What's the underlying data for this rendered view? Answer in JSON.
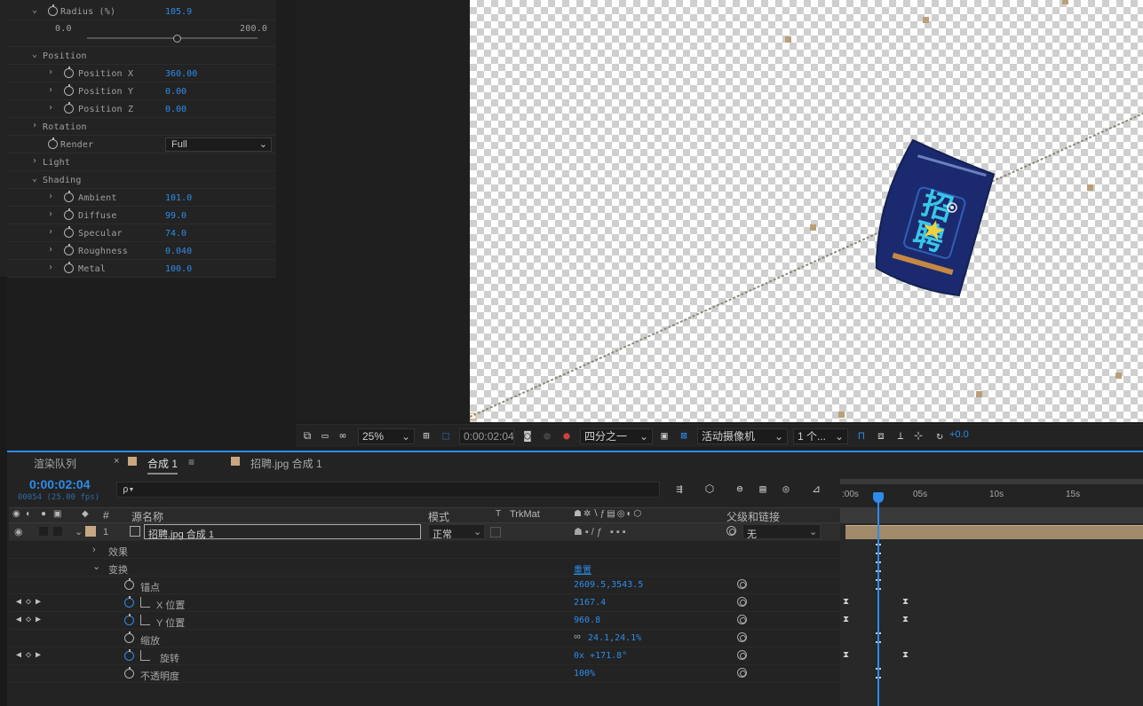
{
  "effects": {
    "radius_label": "Radius (%)",
    "radius_value": "105.9",
    "radius_min": "0.0",
    "radius_max": "200.0",
    "radius_slider_fraction": 0.529,
    "position_label": "Position",
    "position_x_label": "Position X",
    "position_x_value": "360.00",
    "position_y_label": "Position Y",
    "position_y_value": "0.00",
    "position_z_label": "Position Z",
    "position_z_value": "0.00",
    "rotation_label": "Rotation",
    "render_label": "Render",
    "render_value": "Full",
    "light_label": "Light",
    "shading_label": "Shading",
    "ambient_label": "Ambient",
    "ambient_value": "101.0",
    "diffuse_label": "Diffuse",
    "diffuse_value": "99.0",
    "specular_label": "Specular",
    "specular_value": "74.0",
    "roughness_label": "Roughness",
    "roughness_value": "0.040",
    "metal_label": "Metal",
    "metal_value": "100.0"
  },
  "viewer": {
    "zoom": "25%",
    "timecode": "0:00:02:04",
    "resolution": "四分之一",
    "camera": "活动摄像机",
    "views": "1 个...",
    "exposure": "+0.0"
  },
  "timeline": {
    "tab_render_queue": "渲染队列",
    "tab_comp": "合成 1",
    "tab_menu": "≡",
    "tab_close": "×",
    "tab_other": "招聘.jpg 合成 1",
    "timecode": "0:00:02:04",
    "frames": "00054 (25.00 fps)",
    "search_placeholder": "ρ▾",
    "col_number": "#",
    "col_source": "源名称",
    "col_mode": "模式",
    "col_t": "T",
    "col_trkmat": "TrkMat",
    "col_parent": "父级和链接",
    "layer_number": "1",
    "layer_name": "招聘.jpg 合成 1",
    "layer_mode": "正常",
    "layer_parent": "无",
    "effects_group": "效果",
    "transform_group": "变换",
    "reset": "重置",
    "anchor_label": "锚点",
    "anchor_value": "2609.5,3543.5",
    "xpos_label": "X 位置",
    "xpos_value": "2167.4",
    "ypos_label": "Y 位置",
    "ypos_value": "960.8",
    "scale_label": "缩放",
    "scale_value": "24.1,24.1%",
    "rotate_label": "旋转",
    "rotate_value": "0x +171.8°",
    "opacity_label": "不透明度",
    "opacity_value": "100%",
    "ticks": [
      ":00s",
      "05s",
      "10s",
      "15s"
    ]
  },
  "colors": {
    "accent": "#2d8ceb",
    "label": "#c8a882"
  }
}
